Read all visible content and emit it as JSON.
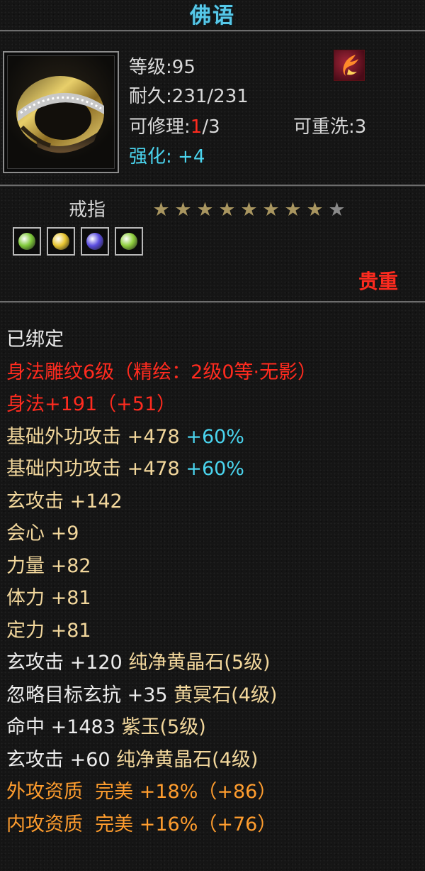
{
  "title": "佛语",
  "item": {
    "icon": "ring-icon",
    "badge_icon": "phoenix-badge-icon",
    "level_label": "等级",
    "level_value": "95",
    "durability_label": "耐久",
    "durability_value": "231/231",
    "repair_label": "可修理",
    "repair_used": "1",
    "repair_total": "/3",
    "rewash_label": "可重洗",
    "rewash_value": "3",
    "enhance_label": "强化",
    "enhance_value": "+4",
    "type": "戒指",
    "stars_filled": 8,
    "stars_total": 9,
    "gems": [
      {
        "icon": "green-gem-icon",
        "color": "#7fc93a"
      },
      {
        "icon": "yellow-gem-icon",
        "color": "#e7c531"
      },
      {
        "icon": "purple-gem-icon",
        "color": "#5b4de0"
      },
      {
        "icon": "green-gem-icon",
        "color": "#8fcf3e"
      }
    ],
    "rarity": "贵重"
  },
  "attributes": [
    [
      {
        "t": "已绑定",
        "c": "white"
      }
    ],
    [
      {
        "t": "身法雕纹6级（精绘：2级0等·无影）",
        "c": "red"
      }
    ],
    [
      {
        "t": "身法+191（+51）",
        "c": "red"
      }
    ],
    [
      {
        "t": "基础外功攻击 +478 ",
        "c": "gold"
      },
      {
        "t": "+60%",
        "c": "cyan"
      }
    ],
    [
      {
        "t": "基础内功攻击 +478 ",
        "c": "gold"
      },
      {
        "t": "+60%",
        "c": "cyan"
      }
    ],
    [
      {
        "t": "玄攻击 +142",
        "c": "gold"
      }
    ],
    [
      {
        "t": "会心 +9",
        "c": "gold"
      }
    ],
    [
      {
        "t": "力量 +82",
        "c": "gold"
      }
    ],
    [
      {
        "t": "体力 +81",
        "c": "gold"
      }
    ],
    [
      {
        "t": "定力 +81",
        "c": "gold"
      }
    ],
    [
      {
        "t": "玄攻击 +120 ",
        "c": "white"
      },
      {
        "t": "纯净黄晶石(5级)",
        "c": "gold"
      }
    ],
    [
      {
        "t": "忽略目标玄抗 +35 ",
        "c": "white"
      },
      {
        "t": "黄冥石(4级)",
        "c": "gold"
      }
    ],
    [
      {
        "t": "命中 +1483 ",
        "c": "white"
      },
      {
        "t": "紫玉(5级)",
        "c": "gold"
      }
    ],
    [
      {
        "t": "玄攻击 +60 ",
        "c": "white"
      },
      {
        "t": "纯净黄晶石(4级)",
        "c": "gold"
      }
    ],
    [
      {
        "t": "外攻资质  完美 +18%（+86）",
        "c": "orange"
      }
    ],
    [
      {
        "t": "内攻资质  完美 +16%（+76）",
        "c": "orange"
      }
    ]
  ],
  "colors": {
    "title": "#56c8e8",
    "white": "#ececec",
    "red": "#ff2b1f",
    "gold": "#f2d79c",
    "cyan": "#4ad4ee",
    "orange": "#ff9d2e",
    "star_filled": "#a99660",
    "star_empty": "#8a8a8a"
  }
}
